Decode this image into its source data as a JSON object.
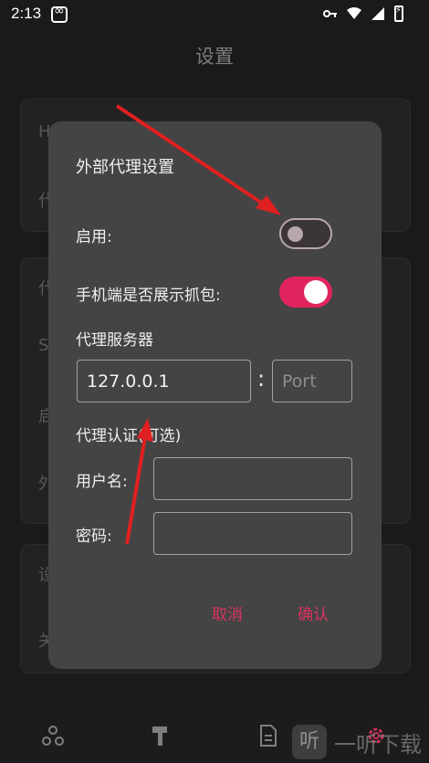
{
  "status_bar": {
    "time": "2:13",
    "icons": [
      "key-icon",
      "wifi-icon",
      "signal-icon",
      "battery-charging-icon"
    ]
  },
  "page": {
    "title": "设置",
    "bg_rows": [
      "H",
      "代",
      "代",
      "S",
      "启",
      "外",
      "设",
      "关"
    ]
  },
  "dialog": {
    "title": "外部代理设置",
    "enable_label": "启用:",
    "enable_on": false,
    "show_capture_label": "手机端是否展示抓包:",
    "show_capture_on": true,
    "proxy_server_label": "代理服务器",
    "host_value": "127.0.0.1",
    "port_placeholder": "Port",
    "colon": ":",
    "auth_label": "代理认证(可选)",
    "username_label": "用户名:",
    "username_value": "",
    "password_label": "密码:",
    "password_value": "",
    "cancel_label": "取消",
    "confirm_label": "确认"
  },
  "bottom_nav": {
    "items": [
      "share-nodes-icon",
      "hammer-icon",
      "document-icon",
      "settings-icon"
    ],
    "active": "settings-icon"
  },
  "watermark": {
    "logo_text": "听",
    "text": "一听下载"
  },
  "colors": {
    "accent": "#e0245e",
    "dialog_bg": "#444444",
    "page_bg": "#1a1a1a",
    "arrow": "#e02020"
  }
}
